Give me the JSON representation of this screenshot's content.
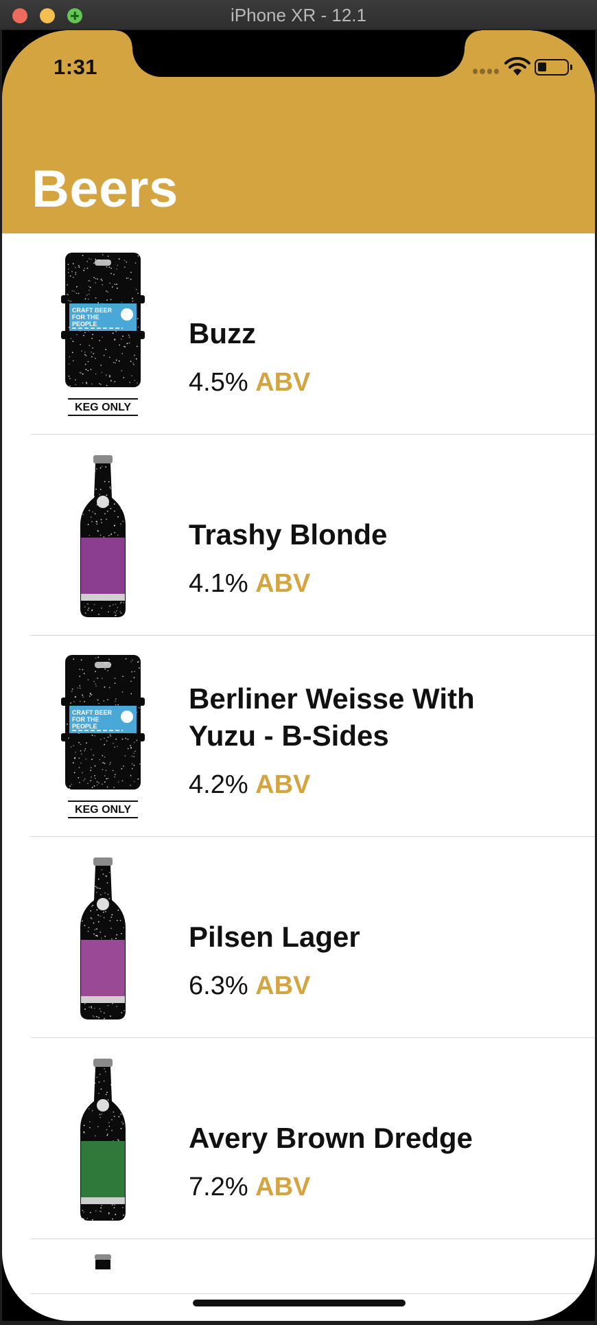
{
  "window": {
    "title": "iPhone XR - 12.1"
  },
  "status_bar": {
    "time": "1:31"
  },
  "header": {
    "title": "Beers",
    "background": "#d4a441"
  },
  "accent_color": "#d4a441",
  "beers": [
    {
      "name": "Buzz",
      "abv_value": "4.5%",
      "abv_unit": "ABV",
      "image": "keg",
      "label_color": "#4aa8d8",
      "keg_badge": "KEG ONLY",
      "label_text": "CRAFT BEER FOR THE PEOPLE"
    },
    {
      "name": "Trashy Blonde",
      "abv_value": "4.1%",
      "abv_unit": "ABV",
      "image": "bottle",
      "label_color": "#8b3d8f"
    },
    {
      "name": "Berliner Weisse With Yuzu - B-Sides",
      "abv_value": "4.2%",
      "abv_unit": "ABV",
      "image": "keg",
      "label_color": "#4aa8d8",
      "keg_badge": "KEG ONLY",
      "label_text": "CRAFT BEER FOR THE PEOPLE"
    },
    {
      "name": "Pilsen Lager",
      "abv_value": "6.3%",
      "abv_unit": "ABV",
      "image": "bottle",
      "label_color": "#9a4a94"
    },
    {
      "name": "Avery Brown Dredge",
      "abv_value": "7.2%",
      "abv_unit": "ABV",
      "image": "bottle",
      "label_color": "#2f7a3a"
    }
  ]
}
